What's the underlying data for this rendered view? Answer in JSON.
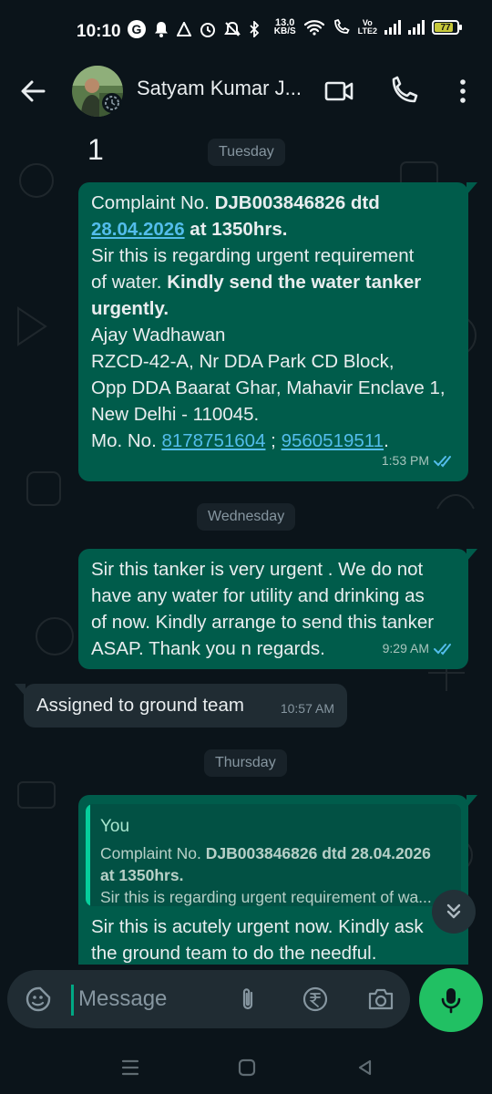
{
  "status_bar": {
    "time": "10:10",
    "g_badge": "G",
    "speed_value": "13.0",
    "speed_unit": "KB/S",
    "volte_line1": "Vo",
    "volte_line2": "LTE2",
    "battery": "77",
    "icons": [
      "google-icon",
      "notification-bell-icon",
      "navigation-arrow-icon",
      "alarm-icon",
      "mute-icon",
      "bluetooth-icon",
      "wifi-icon",
      "call-icon",
      "signal-icon",
      "signal-icon",
      "battery-icon"
    ]
  },
  "header": {
    "contact_name": "Satyam Kumar J...",
    "icons": [
      "back-arrow-icon",
      "video-call-icon",
      "voice-call-icon",
      "more-options-icon"
    ]
  },
  "chat": {
    "stray_text": "1",
    "days": {
      "tuesday": "Tuesday",
      "wednesday": "Wednesday",
      "thursday": "Thursday"
    },
    "msg1": {
      "l1a": "Complaint No. ",
      "l1b": "DJB003846826 dtd",
      "l2_link": "28.04.2026",
      "l2b": " at 1350hrs.",
      "l3": "Sir this is regarding urgent requirement",
      "l4a": "of water. ",
      "l4b": "Kindly send the water tanker",
      "l5": "urgently.",
      "l6": "Ajay Wadhawan",
      "l7": "RZCD-42-A, Nr DDA Park CD Block,",
      "l8": "Opp DDA Baarat Ghar, Mahavir Enclave 1,",
      "l9": "New Delhi - 110045.",
      "l10a": "Mo. No. ",
      "phone1": "8178751604",
      "sep": " ; ",
      "phone2": "9560519511",
      "end": ".",
      "time": "1:53 PM"
    },
    "msg2": {
      "l1": "Sir this tanker is very urgent . We do not",
      "l2": "have any water for utility and drinking as",
      "l3": "of now. Kindly arrange to send this tanker",
      "l4": "ASAP. Thank you n regards.",
      "time": "9:29 AM"
    },
    "msg3": {
      "text": "Assigned to ground team",
      "time": "10:57 AM"
    },
    "msg4": {
      "quote_author": "You",
      "quote_l1a": "Complaint No. ",
      "quote_l1b": "DJB003846826 dtd 28.04.2026",
      "quote_l2": "at 1350hrs.",
      "quote_l3": "Sir this is regarding urgent requirement of wa...",
      "l1": "Sir this is acutely urgent now. Kindly ask",
      "l2": "the ground team to do the needful."
    }
  },
  "composer": {
    "placeholder": "Message",
    "icons": [
      "emoji-sticker-icon",
      "attach-icon",
      "rupee-payment-icon",
      "camera-icon",
      "mic-icon"
    ]
  },
  "colors": {
    "background": "#0b141a",
    "outgoing_bubble": "#005c4b",
    "incoming_bubble": "#202c33",
    "accent_green": "#21c063",
    "link_blue": "#53bdeb",
    "read_tick_blue": "#53bdeb"
  }
}
